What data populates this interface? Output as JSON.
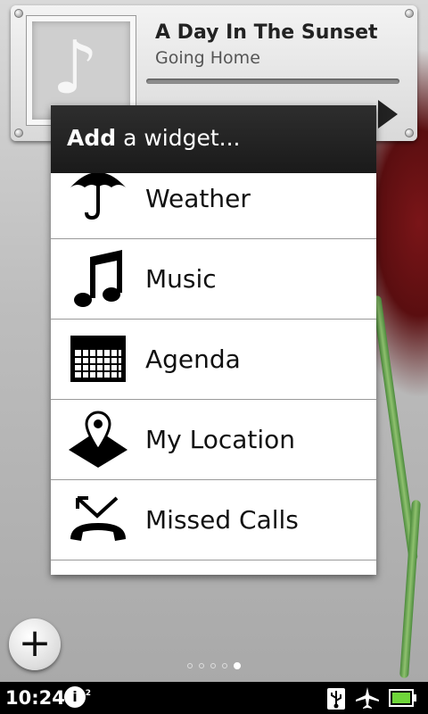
{
  "music_widget": {
    "track_title": "A Day In The Sunset",
    "artist": "Going Home"
  },
  "dialog": {
    "title_bold": "Add",
    "title_rest": " a widget..."
  },
  "widgets": [
    {
      "label": "Weather",
      "icon": "umbrella-icon"
    },
    {
      "label": "Music",
      "icon": "music-note-icon"
    },
    {
      "label": "Agenda",
      "icon": "calendar-icon"
    },
    {
      "label": "My Location",
      "icon": "location-pin-icon"
    },
    {
      "label": "Missed Calls",
      "icon": "missed-call-icon"
    }
  ],
  "home": {
    "add_symbol": "+",
    "page_count": 5,
    "active_page": 5
  },
  "status_bar": {
    "time": "10:24",
    "badge_letter": "i",
    "badge_sup": "2"
  }
}
